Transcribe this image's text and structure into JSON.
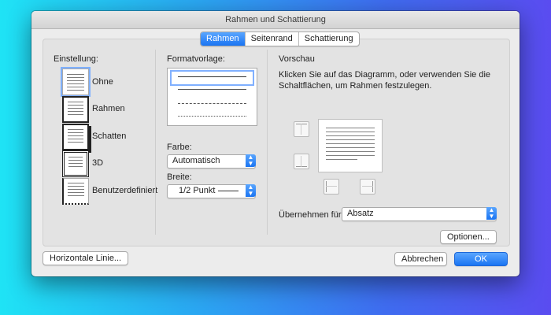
{
  "window": {
    "title": "Rahmen und Schattierung"
  },
  "tabs": [
    {
      "label": "Rahmen",
      "active": true
    },
    {
      "label": "Seitenrand",
      "active": false
    },
    {
      "label": "Schattierung",
      "active": false
    }
  ],
  "setting": {
    "heading": "Einstellung:",
    "items": [
      {
        "label": "Ohne",
        "icon": "no-border-icon",
        "selected": true
      },
      {
        "label": "Rahmen",
        "icon": "box-border-icon"
      },
      {
        "label": "Schatten",
        "icon": "shadow-border-icon"
      },
      {
        "label": "3D",
        "icon": "3d-border-icon"
      },
      {
        "label": "Benutzerdefiniert",
        "icon": "custom-border-icon"
      }
    ]
  },
  "format": {
    "heading": "Formatvorlage:",
    "styles": [
      "solid",
      "solid-thin",
      "dashed",
      "dotted"
    ],
    "color_label": "Farbe:",
    "color_value": "Automatisch",
    "width_label": "Breite:",
    "width_value": "1/2 Punkt"
  },
  "preview": {
    "heading": "Vorschau",
    "instruction": "Klicken Sie auf das Diagramm, oder verwenden Sie die Schaltflächen, um Rahmen festzulegen.",
    "apply_label": "Übernehmen für:",
    "apply_value": "Absatz"
  },
  "buttons": {
    "options": "Optionen...",
    "horizontal_line": "Horizontale Linie...",
    "cancel": "Abbrechen",
    "ok": "OK"
  },
  "colors": {
    "accent": "#1a74f2"
  }
}
